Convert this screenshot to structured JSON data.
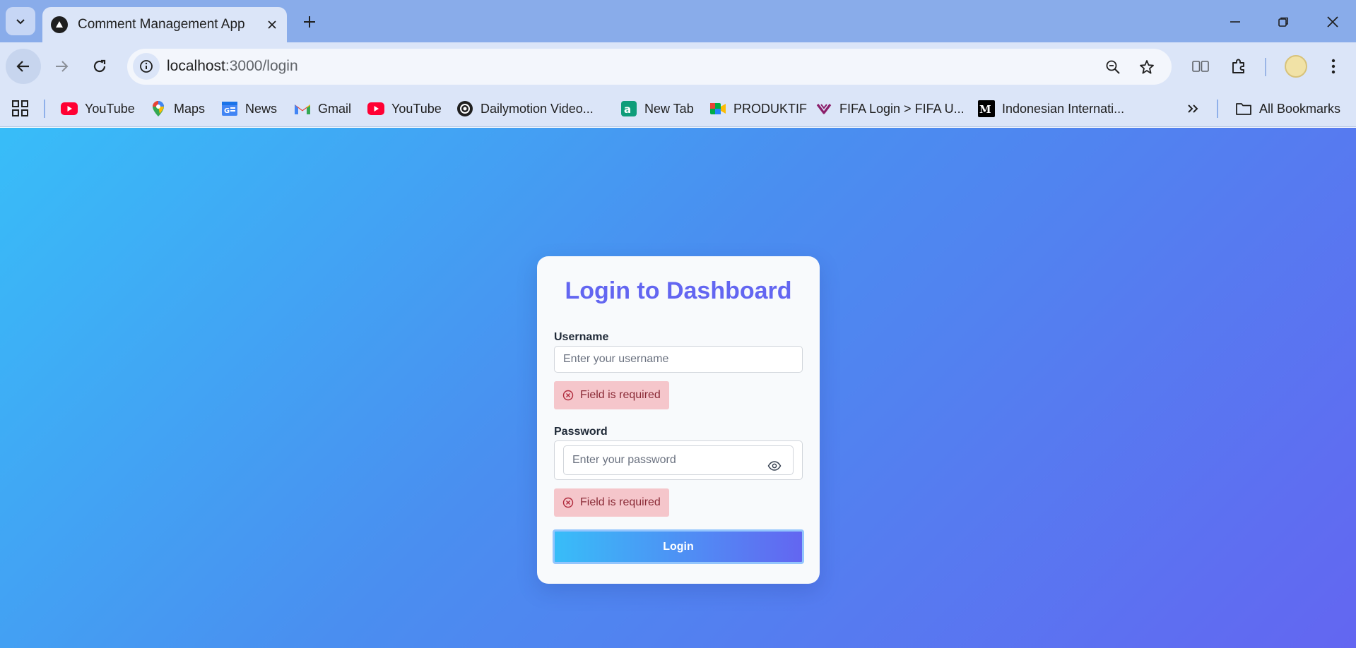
{
  "browser": {
    "tab": {
      "title": "Comment Management App"
    },
    "url": {
      "host": "localhost",
      "path": ":3000/login"
    },
    "bookmarks": [
      {
        "label": "YouTube",
        "icon": "youtube-icon"
      },
      {
        "label": "Maps",
        "icon": "maps-icon"
      },
      {
        "label": "News",
        "icon": "news-icon"
      },
      {
        "label": "Gmail",
        "icon": "gmail-icon"
      },
      {
        "label": "YouTube",
        "icon": "youtube-icon"
      },
      {
        "label": "Dailymotion Video...",
        "icon": "dailymotion-icon"
      },
      {
        "label": "New Tab",
        "icon": "newtab-icon"
      },
      {
        "label": "PRODUKTIF",
        "icon": "meet-icon"
      },
      {
        "label": "FIFA Login > FIFA U...",
        "icon": "fifa-icon"
      },
      {
        "label": "Indonesian Internati...",
        "icon": "medium-icon"
      }
    ],
    "all_bookmarks_label": "All Bookmarks"
  },
  "login": {
    "title": "Login to Dashboard",
    "username_label": "Username",
    "username_placeholder": "Enter your username",
    "username_value": "",
    "username_error": "Field is required",
    "password_label": "Password",
    "password_placeholder": "Enter your password",
    "password_value": "",
    "password_error": "Field is required",
    "submit_label": "Login"
  },
  "colors": {
    "accent": "#6366f1",
    "gradient_start": "#38bdf8",
    "gradient_end": "#6366f1",
    "error_bg": "#f5c6cb",
    "error_text": "#8a2a36"
  }
}
